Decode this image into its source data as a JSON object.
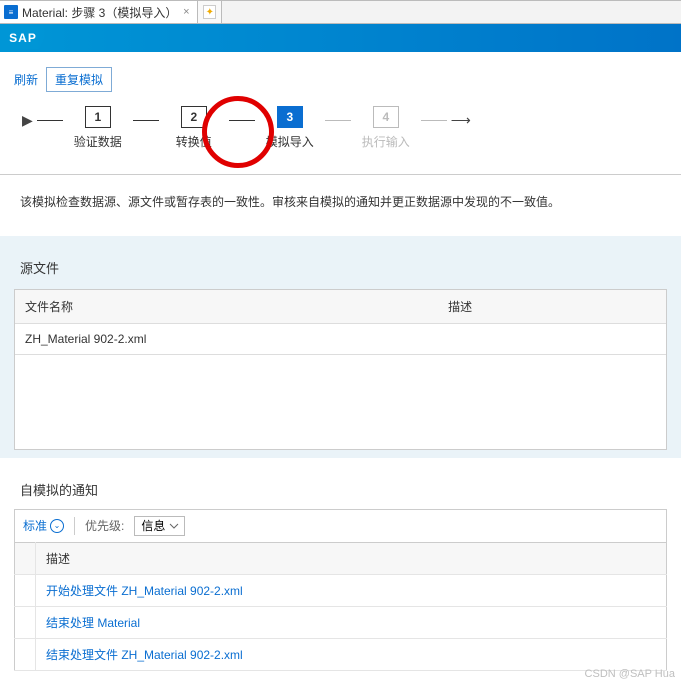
{
  "window": {
    "tab_title": "Material: 步骤 3（模拟导入）",
    "tab_icon": "≡"
  },
  "brand": {
    "logo": "SAP"
  },
  "toolbar": {
    "refresh": "刷新",
    "repeat_sim": "重复模拟"
  },
  "wizard": {
    "steps": [
      {
        "num": "1",
        "label": "验证数据"
      },
      {
        "num": "2",
        "label": "转换值"
      },
      {
        "num": "3",
        "label": "模拟导入"
      },
      {
        "num": "4",
        "label": "执行输入"
      }
    ]
  },
  "description": "该模拟检查数据源、源文件或暂存表的一致性。审核来自模拟的通知并更正数据源中发现的不一致值。",
  "source_files": {
    "title": "源文件",
    "col_name": "文件名称",
    "col_desc": "描述",
    "rows": [
      {
        "name": "ZH_Material 902-2.xml",
        "desc": ""
      }
    ]
  },
  "notifications": {
    "title": "自模拟的通知",
    "standard": "标准",
    "priority_label": "优先级:",
    "priority_value": "信息",
    "col_desc": "描述",
    "rows": [
      {
        "text": "开始处理文件 ZH_Material 902-2.xml"
      },
      {
        "text": "结束处理 Material"
      },
      {
        "text": "结束处理文件 ZH_Material 902-2.xml"
      }
    ]
  },
  "watermark": "CSDN @SAP Hua"
}
